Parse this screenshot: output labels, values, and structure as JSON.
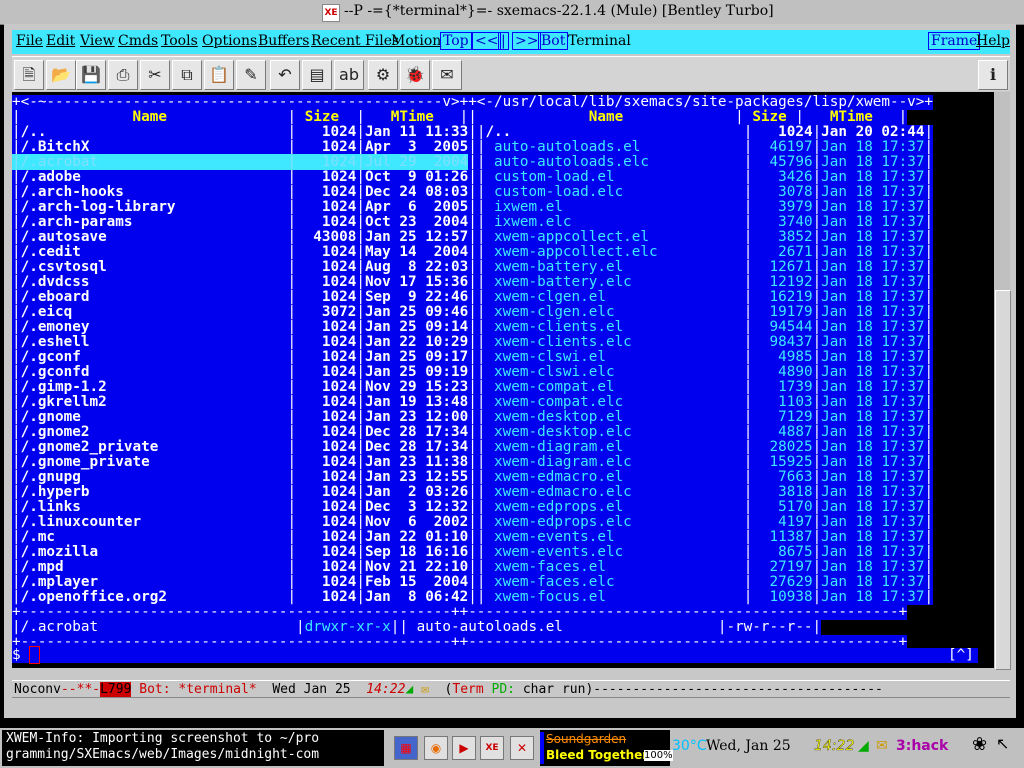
{
  "window": {
    "title": "--P  -={*terminal*}=- sxemacs-22.1.4 (Mule) [Bentley Turbo]",
    "icon": "XE"
  },
  "menubar": {
    "items": [
      "File",
      "Edit",
      "View",
      "Cmds",
      "Tools",
      "Options",
      "Buffers",
      "Recent Files",
      "Motion"
    ],
    "nav_buttons": [
      "Top",
      "<<",
      "|",
      ">>",
      "Bot"
    ],
    "terminal_label": "Terminal",
    "right": [
      "Frame",
      "Help"
    ]
  },
  "toolbar": {
    "icons": [
      "new-file-icon",
      "open-folder-icon",
      "save-icon",
      "print-icon",
      "cut-icon",
      "copy-icon",
      "paste-icon",
      "clear-icon",
      "undo-icon",
      "spell-icon",
      "replace-icon",
      "compile-icon",
      "debug-icon",
      "news-icon"
    ],
    "info_icon": "info-icon"
  },
  "terminal": {
    "left_header_path": "+<-~----------------------------------------------v>+",
    "right_header_path": "+<-/usr/local/lib/sxemacs/site-packages/lisp/xwem--v>+",
    "columns": {
      "name": "Name",
      "size": "Size",
      "mtime": "MTime"
    },
    "left_rows": [
      [
        "/..",
        "1024",
        "Jan 11 11:33"
      ],
      [
        "/.BitchX",
        "1024",
        "Apr  3  2005"
      ],
      [
        "/.acrobat",
        "1024",
        "Jul 29  2004"
      ],
      [
        "/.adobe",
        "1024",
        "Oct  9 01:26"
      ],
      [
        "/.arch-hooks",
        "1024",
        "Dec 24 08:03"
      ],
      [
        "/.arch-log-library",
        "1024",
        "Apr  6  2005"
      ],
      [
        "/.arch-params",
        "1024",
        "Oct 23  2004"
      ],
      [
        "/.autosave",
        "43008",
        "Jan 25 12:57"
      ],
      [
        "/.cedit",
        "1024",
        "May 14  2004"
      ],
      [
        "/.csvtosql",
        "1024",
        "Aug  8 22:03"
      ],
      [
        "/.dvdcss",
        "1024",
        "Nov 17 15:36"
      ],
      [
        "/.eboard",
        "1024",
        "Sep  9 22:46"
      ],
      [
        "/.eicq",
        "3072",
        "Jan 25 09:46"
      ],
      [
        "/.emoney",
        "1024",
        "Jan 25 09:14"
      ],
      [
        "/.eshell",
        "1024",
        "Jan 22 10:29"
      ],
      [
        "/.gconf",
        "1024",
        "Jan 25 09:17"
      ],
      [
        "/.gconfd",
        "1024",
        "Jan 25 09:19"
      ],
      [
        "/.gimp-1.2",
        "1024",
        "Nov 29 15:23"
      ],
      [
        "/.gkrellm2",
        "1024",
        "Jan 19 13:48"
      ],
      [
        "/.gnome",
        "1024",
        "Jan 23 12:00"
      ],
      [
        "/.gnome2",
        "1024",
        "Dec 28 17:34"
      ],
      [
        "/.gnome2_private",
        "1024",
        "Dec 28 17:34"
      ],
      [
        "/.gnome_private",
        "1024",
        "Jan 23 11:38"
      ],
      [
        "/.gnupg",
        "1024",
        "Jan 23 12:55"
      ],
      [
        "/.hyperb",
        "1024",
        "Jan  2 03:26"
      ],
      [
        "/.links",
        "1024",
        "Dec  3 12:32"
      ],
      [
        "/.linuxcounter",
        "1024",
        "Nov  6  2002"
      ],
      [
        "/.mc",
        "1024",
        "Jan 22 01:10"
      ],
      [
        "/.mozilla",
        "1024",
        "Sep 18 16:16"
      ],
      [
        "/.mpd",
        "1024",
        "Nov 21 22:10"
      ],
      [
        "/.mplayer",
        "1024",
        "Feb 15  2004"
      ],
      [
        "/.openoffice.org2",
        "1024",
        "Jan  8 06:42"
      ]
    ],
    "right_rows": [
      [
        "/..",
        "1024",
        "Jan 20 02:44"
      ],
      [
        "auto-autoloads.el",
        "46197",
        "Jan 18 17:37"
      ],
      [
        "auto-autoloads.elc",
        "45796",
        "Jan 18 17:37"
      ],
      [
        "custom-load.el",
        "3426",
        "Jan 18 17:37"
      ],
      [
        "custom-load.elc",
        "3078",
        "Jan 18 17:37"
      ],
      [
        "ixwem.el",
        "3979",
        "Jan 18 17:37"
      ],
      [
        "ixwem.elc",
        "3740",
        "Jan 18 17:37"
      ],
      [
        "xwem-appcollect.el",
        "3852",
        "Jan 18 17:37"
      ],
      [
        "xwem-appcollect.elc",
        "2671",
        "Jan 18 17:37"
      ],
      [
        "xwem-battery.el",
        "12671",
        "Jan 18 17:37"
      ],
      [
        "xwem-battery.elc",
        "12192",
        "Jan 18 17:37"
      ],
      [
        "xwem-clgen.el",
        "16219",
        "Jan 18 17:37"
      ],
      [
        "xwem-clgen.elc",
        "19179",
        "Jan 18 17:37"
      ],
      [
        "xwem-clients.el",
        "94544",
        "Jan 18 17:37"
      ],
      [
        "xwem-clients.elc",
        "98437",
        "Jan 18 17:37"
      ],
      [
        "xwem-clswi.el",
        "4985",
        "Jan 18 17:37"
      ],
      [
        "xwem-clswi.elc",
        "4890",
        "Jan 18 17:37"
      ],
      [
        "xwem-compat.el",
        "1739",
        "Jan 18 17:37"
      ],
      [
        "xwem-compat.elc",
        "1103",
        "Jan 18 17:37"
      ],
      [
        "xwem-desktop.el",
        "7129",
        "Jan 18 17:37"
      ],
      [
        "xwem-desktop.elc",
        "4887",
        "Jan 18 17:37"
      ],
      [
        "xwem-diagram.el",
        "28025",
        "Jan 18 17:37"
      ],
      [
        "xwem-diagram.elc",
        "15925",
        "Jan 18 17:37"
      ],
      [
        "xwem-edmacro.el",
        "7663",
        "Jan 18 17:37"
      ],
      [
        "xwem-edmacro.elc",
        "3818",
        "Jan 18 17:37"
      ],
      [
        "xwem-edprops.el",
        "5170",
        "Jan 18 17:37"
      ],
      [
        "xwem-edprops.elc",
        "4197",
        "Jan 18 17:37"
      ],
      [
        "xwem-events.el",
        "11387",
        "Jan 18 17:37"
      ],
      [
        "xwem-events.elc",
        "8675",
        "Jan 18 17:37"
      ],
      [
        "xwem-faces.el",
        "27197",
        "Jan 18 17:37"
      ],
      [
        "xwem-faces.elc",
        "27629",
        "Jan 18 17:37"
      ],
      [
        "xwem-focus.el",
        "10938",
        "Jan 18 17:37"
      ]
    ],
    "left_footer": "/.acrobat",
    "left_perm": "drwxr-xr-x",
    "right_footer": "auto-autoloads.el",
    "right_perm": "-rw-r--r--",
    "prompt": "$",
    "bracket": "[^]"
  },
  "modeline": {
    "noconv": "Noconv",
    "dashes": "--**-",
    "line": "L799",
    "pos": "Bot:",
    "buffer": "*terminal*",
    "date": "Wed Jan 25",
    "time": "14:22",
    "mode_open": "(",
    "mode": "Term",
    "pd": "PD:",
    "run": "char run)"
  },
  "taskbar": {
    "info_line1": "XWEM-Info: Importing screenshot to ~/pro",
    "info_line2": "gramming/SXEmacs/web/Images/midnight-com",
    "music_artist": "Soundgarden",
    "music_track": "Bleed Together",
    "music_progress": "100%",
    "temperature": "30°C",
    "date": "Wed, Jan 25",
    "time": "14:22",
    "workspace": "3:hack",
    "colors": {
      "temp": "#00c0ff",
      "time": "#ffff00",
      "workspace": "#aa00aa"
    }
  }
}
